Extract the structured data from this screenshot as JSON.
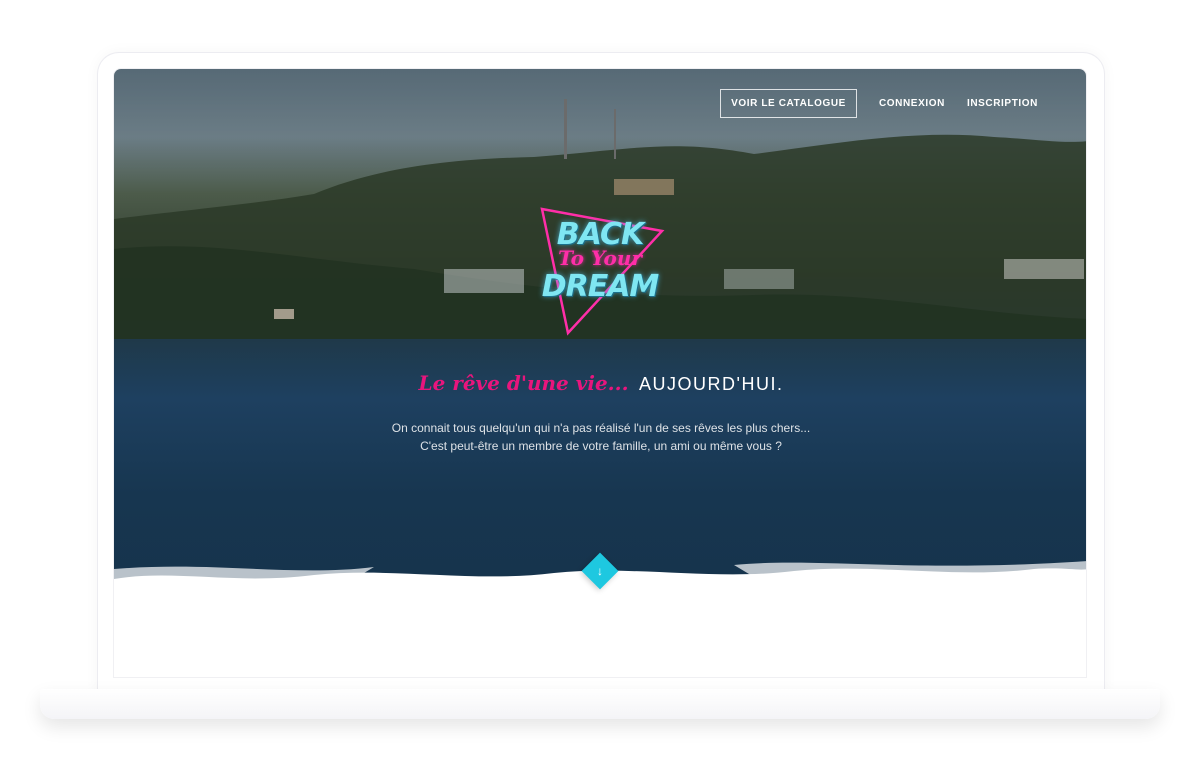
{
  "nav": {
    "catalogue": "VOIR LE CATALOGUE",
    "login": "CONNEXION",
    "signup": "INSCRIPTION"
  },
  "logo": {
    "line1": "BACK",
    "line2": "To Your",
    "line3": "DREAM"
  },
  "hero": {
    "headline_script": "Le rêve d'une vie...",
    "headline_caps": "AUJOURD'HUI.",
    "intro_line1": "On connait tous quelqu'un qui n'a pas réalisé l'un de ses rêves les plus chers...",
    "intro_line2": "C'est peut-être un membre de votre famille, un ami ou même vous ?"
  },
  "scroll": {
    "icon": "arrow-down-icon"
  },
  "colors": {
    "accent_cyan": "#1ec8e0",
    "accent_pink": "#e8157d"
  }
}
